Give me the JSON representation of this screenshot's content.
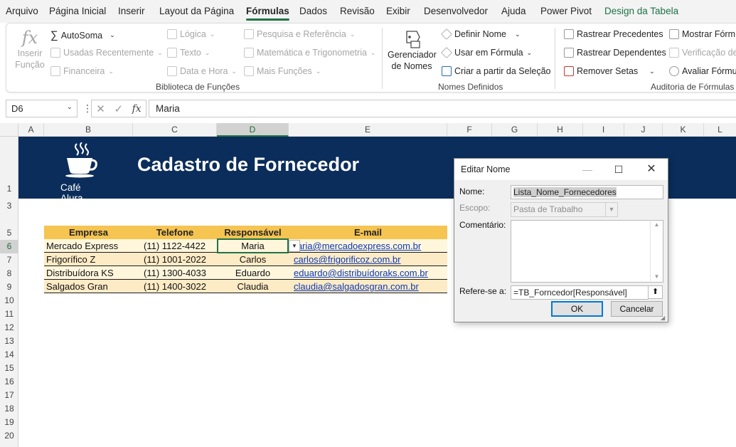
{
  "menu": {
    "tabs": [
      "Arquivo",
      "Página Inicial",
      "Inserir",
      "Layout da Página",
      "Fórmulas",
      "Dados",
      "Revisão",
      "Exibir",
      "Desenvolvedor",
      "Ajuda",
      "Power Pivot",
      "Design da Tabela"
    ],
    "active_tab": "Fórmulas"
  },
  "ribbon": {
    "insert_function": "Inserir Função",
    "autosum": "AutoSoma",
    "recently_used": "Usadas Recentemente",
    "financial": "Financeira",
    "logical": "Lógica",
    "text": "Texto",
    "date_time": "Data e Hora",
    "lookup_reference": "Pesquisa e Referência",
    "math_trig": "Matemática e Trigonometria",
    "more_functions": "Mais Funções",
    "library_label": "Biblioteca de Funções",
    "name_manager": "Gerenciador de Nomes",
    "define_name": "Definir Nome",
    "use_in_formula": "Usar em Fórmula",
    "create_from_selection": "Criar a partir da Seleção",
    "defined_names_label": "Nomes Definidos",
    "trace_precedents": "Rastrear Precedentes",
    "trace_dependents": "Rastrear Dependentes",
    "remove_arrows": "Remover Setas",
    "show_formulas": "Mostrar Fórm",
    "error_checking": "Verificação de",
    "evaluate_formula": "Avaliar Fórmu",
    "auditing_label": "Auditoria de Fórmulas"
  },
  "formula_bar": {
    "name_box": "D6",
    "fx": "fx",
    "content": "Maria"
  },
  "grid": {
    "columns": [
      "A",
      "B",
      "C",
      "D",
      "E",
      "F",
      "G",
      "H",
      "I",
      "J",
      "K",
      "L"
    ],
    "selected_column": "D",
    "rows": [
      "1",
      "3",
      "5",
      "6",
      "7",
      "8",
      "9",
      "10",
      "11",
      "12",
      "13",
      "14",
      "15",
      "16",
      "17",
      "18",
      "19",
      "20"
    ],
    "selected_row": "6"
  },
  "banner": {
    "logo_line1": "Café",
    "logo_line2": "Alura",
    "title": "Cadastro de Fornecedor",
    "color": "#0b2d5b"
  },
  "table": {
    "headers": [
      "Empresa",
      "Telefone",
      "Responsável",
      "E-mail"
    ],
    "rows": [
      [
        "Mercado Express",
        "(11) 1122-4422",
        "Maria",
        "maria@mercadoexpress.com.br"
      ],
      [
        "Frigorífico Z",
        "(11) 1001-2022",
        "Carlos",
        "carlos@frigorificoz.com.br"
      ],
      [
        "Distribuídora KS",
        "(11) 1300-4033",
        "Eduardo",
        "eduardo@distribuídoraks.com.br"
      ],
      [
        "Salgados Gran",
        "(11) 1400-3022",
        "Claudia",
        "claudia@salgadosgran.com.br"
      ]
    ],
    "header_color": "#f5c451"
  },
  "dialog": {
    "title": "Editar Nome",
    "name_label": "Nome:",
    "name_value": "Lista_Nome_Fornecedores",
    "scope_label": "Escopo:",
    "scope_value": "Pasta de Trabalho",
    "comment_label": "Comentário:",
    "comment_value": "",
    "refers_label": "Refere-se a:",
    "refers_value": "=TB_Forncedor[Responsável]",
    "ok": "OK",
    "cancel": "Cancelar"
  },
  "accent_color": "#217346"
}
